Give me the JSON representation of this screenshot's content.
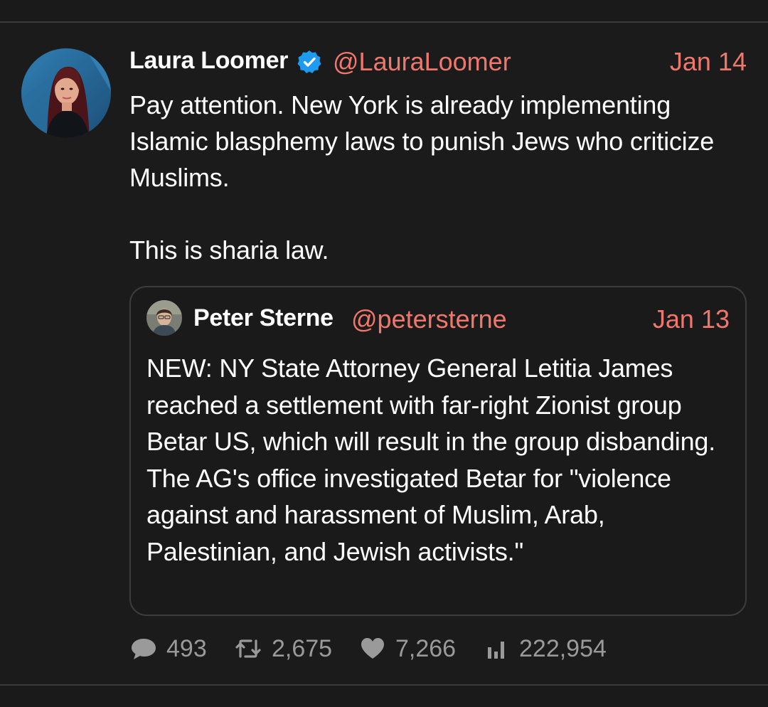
{
  "tweet": {
    "author_name": "Laura Loomer",
    "author_handle": "@LauraLoomer",
    "date": "Jan 14",
    "text": "Pay attention. New York is already implementing Islamic blasphemy laws to punish Jews who criticize Muslims.\n\nThis is sharia law.",
    "verified": true
  },
  "quoted_tweet": {
    "author_name": "Peter Sterne",
    "author_handle": "@petersterne",
    "date": "Jan 13",
    "text": "NEW: NY State Attorney General Letitia James reached a settlement with far-right Zionist group Betar US, which will result in the group disbanding. The AG's office investigated Betar for \"violence against and harassment of Muslim, Arab, Palestinian, and Jewish activists.\""
  },
  "stats": {
    "replies": "493",
    "retweets": "2,675",
    "likes": "7,266",
    "views": "222,954"
  },
  "icons": {
    "verified": "verified-badge-icon",
    "reply": "speech-bubble-icon",
    "retweet": "retweet-icon",
    "like": "heart-icon",
    "views": "bar-chart-icon"
  },
  "colors": {
    "background": "#1b1b1b",
    "accent": "#f0776c",
    "verified": "#1d9bf0",
    "muted": "#9a9a9a",
    "border": "#3c3c3c"
  }
}
